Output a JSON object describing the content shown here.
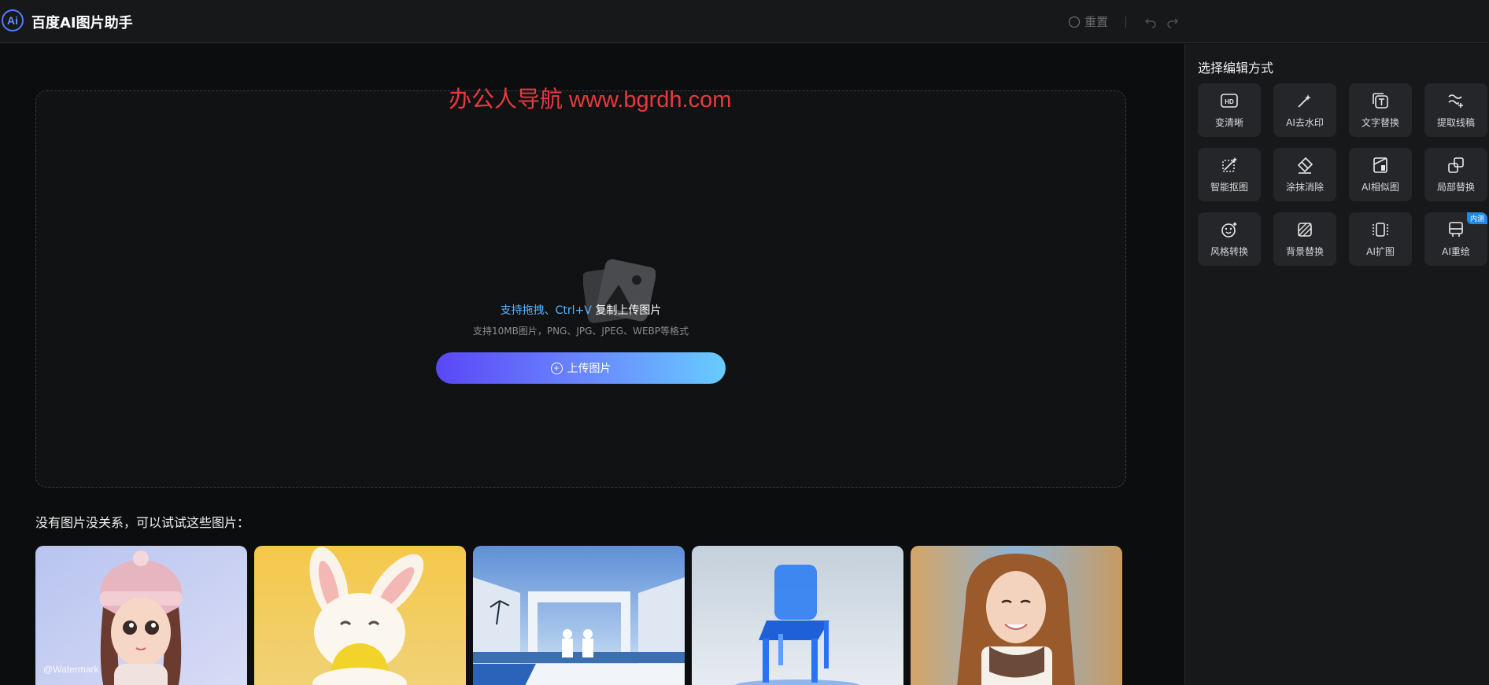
{
  "header": {
    "logo_text": "Ai",
    "title": "百度AI图片助手",
    "reset_label": "重置"
  },
  "main": {
    "overlay_watermark": "办公人导航 www.bgrdh.com",
    "hint_blue": "支持拖拽、Ctrl+V",
    "hint_white": " 复制上传图片",
    "formats": "支持10MB图片，PNG、JPG、JPEG、WEBP等格式",
    "upload_label": "上传图片",
    "samples_title": "没有图片没关系，可以试试这些图片：",
    "sample_watermark": "@Watermark"
  },
  "panel": {
    "title": "选择编辑方式",
    "tools": [
      {
        "label": "变清晰",
        "icon": "hd-icon"
      },
      {
        "label": "AI去水印",
        "icon": "magic-wand-icon"
      },
      {
        "label": "文字替换",
        "icon": "text-replace-icon"
      },
      {
        "label": "提取线稿",
        "icon": "line-art-icon"
      },
      {
        "label": "智能抠图",
        "icon": "cutout-icon"
      },
      {
        "label": "涂抹消除",
        "icon": "eraser-icon"
      },
      {
        "label": "AI相似图",
        "icon": "similar-image-icon"
      },
      {
        "label": "局部替换",
        "icon": "partial-replace-icon"
      },
      {
        "label": "风格转换",
        "icon": "style-transfer-icon"
      },
      {
        "label": "背景替换",
        "icon": "background-replace-icon"
      },
      {
        "label": "AI扩图",
        "icon": "expand-image-icon"
      },
      {
        "label": "AI重绘",
        "icon": "redraw-icon",
        "badge": "内测"
      }
    ]
  },
  "colors": {
    "accent_blue": "#5ab4ff",
    "watermark_red": "#e8393d",
    "button_gradient_start": "#5a47f5",
    "button_gradient_end": "#66ccff"
  }
}
